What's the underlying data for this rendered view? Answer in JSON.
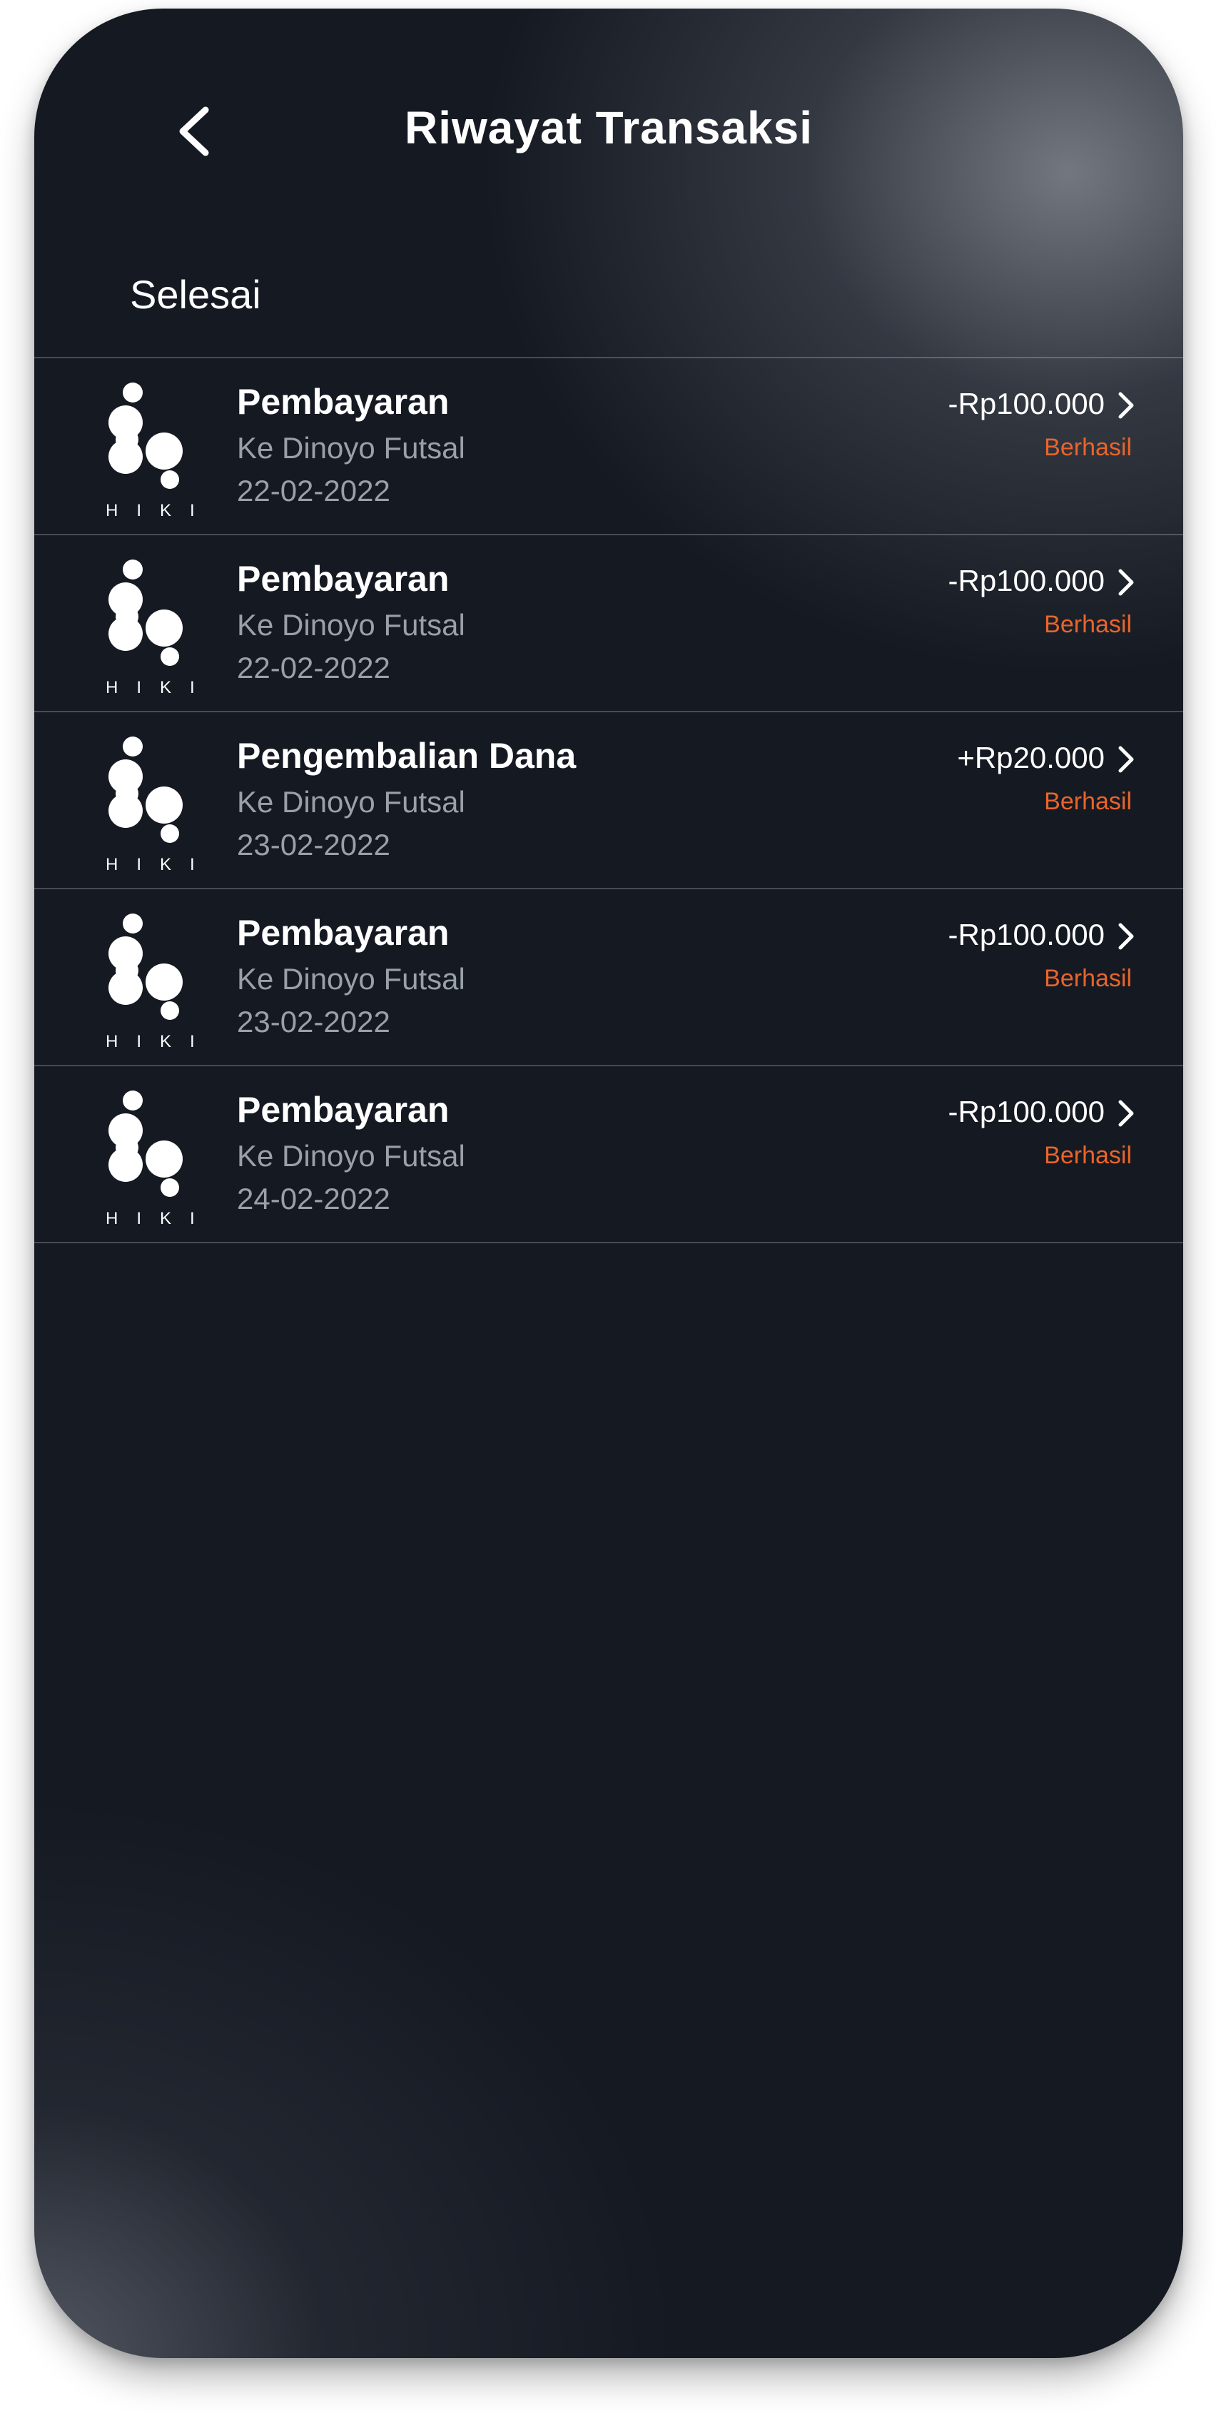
{
  "header": {
    "title": "Riwayat Transaksi",
    "back_icon": "chevron-left-icon"
  },
  "section": {
    "label": "Selesai"
  },
  "transactions": [
    {
      "title": "Pembayaran",
      "subtitle": "Ke Dinoyo Futsal",
      "date": "22-02-2022",
      "amount": "-Rp100.000",
      "status": "Berhasil",
      "logo_text": "HIKI"
    },
    {
      "title": "Pembayaran",
      "subtitle": "Ke Dinoyo Futsal",
      "date": "22-02-2022",
      "amount": "-Rp100.000",
      "status": "Berhasil",
      "logo_text": "HIKI"
    },
    {
      "title": "Pengembalian Dana",
      "subtitle": "Ke Dinoyo Futsal",
      "date": "23-02-2022",
      "amount": "+Rp20.000",
      "status": "Berhasil",
      "logo_text": "HIKI"
    },
    {
      "title": "Pembayaran",
      "subtitle": "Ke Dinoyo Futsal",
      "date": "23-02-2022",
      "amount": "-Rp100.000",
      "status": "Berhasil",
      "logo_text": "HIKI"
    },
    {
      "title": "Pembayaran",
      "subtitle": "Ke Dinoyo Futsal",
      "date": "24-02-2022",
      "amount": "-Rp100.000",
      "status": "Berhasil",
      "logo_text": "HIKI"
    }
  ],
  "colors": {
    "background": "#151922",
    "text_primary": "#ffffff",
    "text_secondary": "#9aa0a8",
    "status_success": "#e8652b"
  }
}
